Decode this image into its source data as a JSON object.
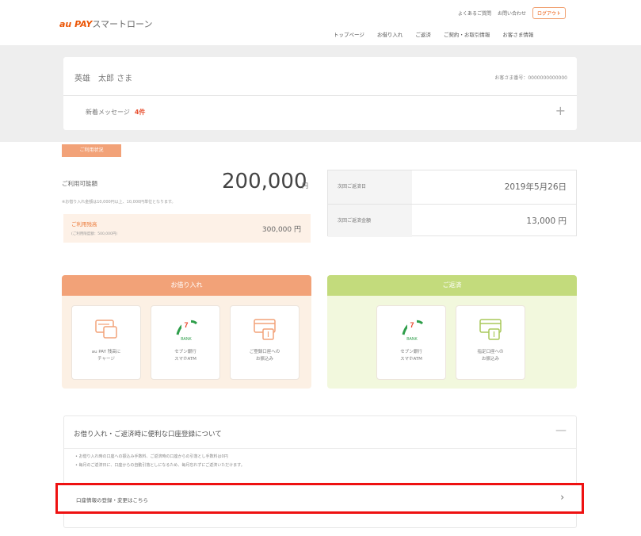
{
  "header": {
    "logo_brand": "au PAY",
    "logo_product": "スマートローン",
    "utility_links": [
      "よくあるご質問",
      "お問い合わせ"
    ],
    "logout_label": "ログアウト",
    "nav": [
      {
        "label": "トップページ",
        "active": true
      },
      {
        "label": "お借り入れ",
        "active": false
      },
      {
        "label": "ご返済",
        "active": false
      },
      {
        "label": "ご契約・お取引情報",
        "active": false
      },
      {
        "label": "お客さま情報",
        "active": false
      }
    ]
  },
  "user": {
    "name": "英雄　太郎 さま",
    "customer_no": "お客さま番号：0000000000000",
    "message_label": "新着メッセージ",
    "message_count": "4件"
  },
  "usage": {
    "tab_label": "ご利用状況",
    "limit_label": "ご利用可能額",
    "limit_amount": "200,000",
    "limit_unit": "円",
    "limit_note": "※お借り入れ金額は10,000円以上、10,000円単位となります。",
    "balance_label": "ご利用残高",
    "balance_sub": "(ご利用限度額：500,000円)",
    "balance_amount": "300,000 円"
  },
  "repayment": {
    "next_date_label": "次回ご返済日",
    "next_date": "2019年5月26日",
    "next_amount_label": "次回ご返済金額",
    "next_amount": "13,000 円"
  },
  "borrow_panel": {
    "title": "お借り入れ",
    "tiles": [
      {
        "label": "au PAY 残高に\nチャージ",
        "icon": "card-charge-icon"
      },
      {
        "label": "セブン銀行\nスマホATM",
        "icon": "seven-bank-icon"
      },
      {
        "label": "ご登録口座への\nお振込み",
        "icon": "bank-transfer-icon"
      }
    ]
  },
  "repay_panel": {
    "title": "ご返済",
    "tiles": [
      {
        "label": "セブン銀行\nスマホATM",
        "icon": "seven-bank-icon"
      },
      {
        "label": "指定口座への\nお振込み",
        "icon": "bank-transfer-icon"
      }
    ]
  },
  "info": {
    "title": "お借り入れ・ご返済時に便利な口座登録について",
    "bullets": [
      "お借り入れ時の口座への振込み手数料、ご返済時の口座からの引落とし手数料は0円",
      "毎月のご返済日に、口座からの自動引落としになるため、毎月忘れずにご返済いただけます。"
    ],
    "register_link": "口座情報の登録・変更はこちら"
  },
  "colors": {
    "accent": "#eb5505",
    "borrow": "#f2a278",
    "repay": "#c3db7c",
    "highlight": "#ee1111"
  }
}
